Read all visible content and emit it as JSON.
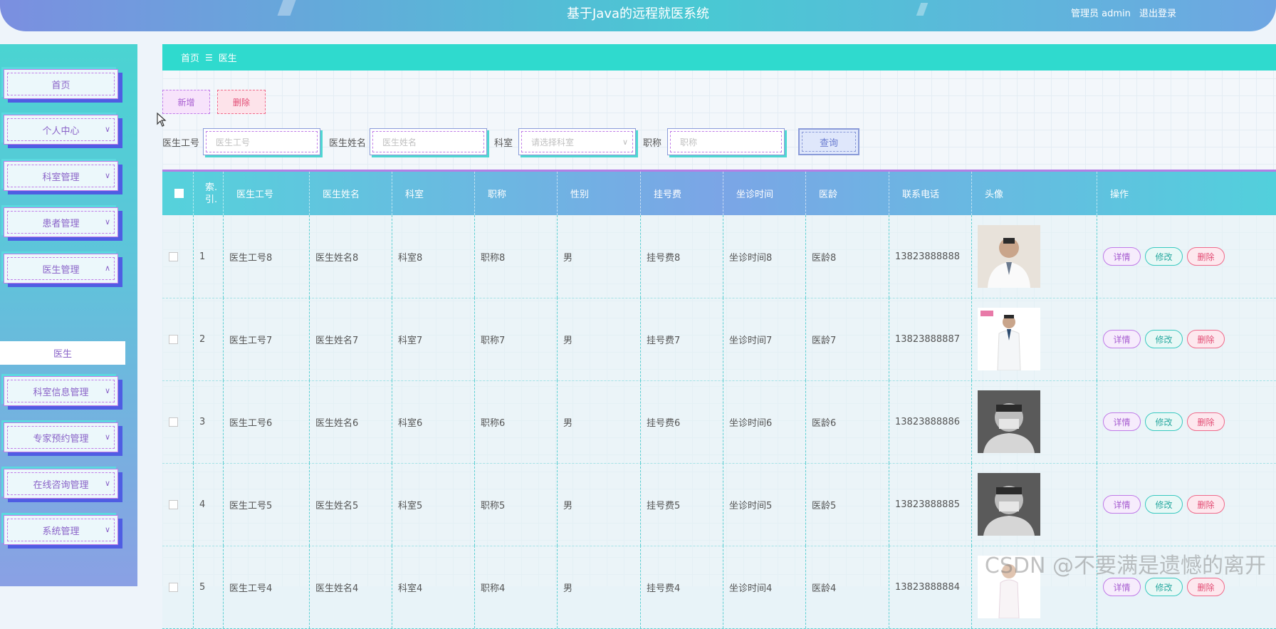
{
  "header": {
    "title": "基于Java的远程就医系统",
    "user_label": "管理员 admin",
    "logout": "退出登录"
  },
  "sidebar": {
    "items": [
      {
        "label": "首页",
        "has_chevron": false
      },
      {
        "label": "个人中心",
        "has_chevron": true
      },
      {
        "label": "科室管理",
        "has_chevron": true
      },
      {
        "label": "患者管理",
        "has_chevron": true
      },
      {
        "label": "医生管理",
        "has_chevron": true,
        "expanded": true
      },
      {
        "label": "科室信息管理",
        "has_chevron": true
      },
      {
        "label": "专家预约管理",
        "has_chevron": true
      },
      {
        "label": "在线咨询管理",
        "has_chevron": true
      },
      {
        "label": "系统管理",
        "has_chevron": true
      }
    ],
    "submenu_active": "医生"
  },
  "breadcrumb": {
    "home": "首页",
    "separator": "☰",
    "current": "医生"
  },
  "toolbar": {
    "add": "新增",
    "delete": "删除"
  },
  "search": {
    "doctor_id_label": "医生工号",
    "doctor_id_placeholder": "医生工号",
    "doctor_name_label": "医生姓名",
    "doctor_name_placeholder": "医生姓名",
    "dept_label": "科室",
    "dept_placeholder": "请选择科室",
    "title_label": "职称",
    "title_placeholder": "职称",
    "query": "查询"
  },
  "table": {
    "headers": [
      "",
      "索引",
      "医生工号",
      "医生姓名",
      "科室",
      "职称",
      "性别",
      "挂号费",
      "坐诊时间",
      "医龄",
      "联系电话",
      "头像",
      "操作"
    ],
    "index_header": "索.\n引.",
    "rows": [
      {
        "index": "1",
        "id": "医生工号8",
        "name": "医生姓名8",
        "dept": "科室8",
        "title": "职称8",
        "gender": "男",
        "fee": "挂号费8",
        "time": "坐诊时间8",
        "age": "医龄8",
        "phone": "13823888888"
      },
      {
        "index": "2",
        "id": "医生工号7",
        "name": "医生姓名7",
        "dept": "科室7",
        "title": "职称7",
        "gender": "男",
        "fee": "挂号费7",
        "time": "坐诊时间7",
        "age": "医龄7",
        "phone": "13823888887"
      },
      {
        "index": "3",
        "id": "医生工号6",
        "name": "医生姓名6",
        "dept": "科室6",
        "title": "职称6",
        "gender": "男",
        "fee": "挂号费6",
        "time": "坐诊时间6",
        "age": "医龄6",
        "phone": "13823888886"
      },
      {
        "index": "4",
        "id": "医生工号5",
        "name": "医生姓名5",
        "dept": "科室5",
        "title": "职称5",
        "gender": "男",
        "fee": "挂号费5",
        "time": "坐诊时间5",
        "age": "医龄5",
        "phone": "13823888885"
      },
      {
        "index": "5",
        "id": "医生工号4",
        "name": "医生姓名4",
        "dept": "科室4",
        "title": "职称4",
        "gender": "男",
        "fee": "挂号费4",
        "time": "坐诊时间4",
        "age": "医龄4",
        "phone": "13823888884"
      }
    ],
    "ops": {
      "detail": "详情",
      "edit": "修改",
      "delete": "删除"
    }
  },
  "watermark": "CSDN @不要满是遗憾的离开"
}
